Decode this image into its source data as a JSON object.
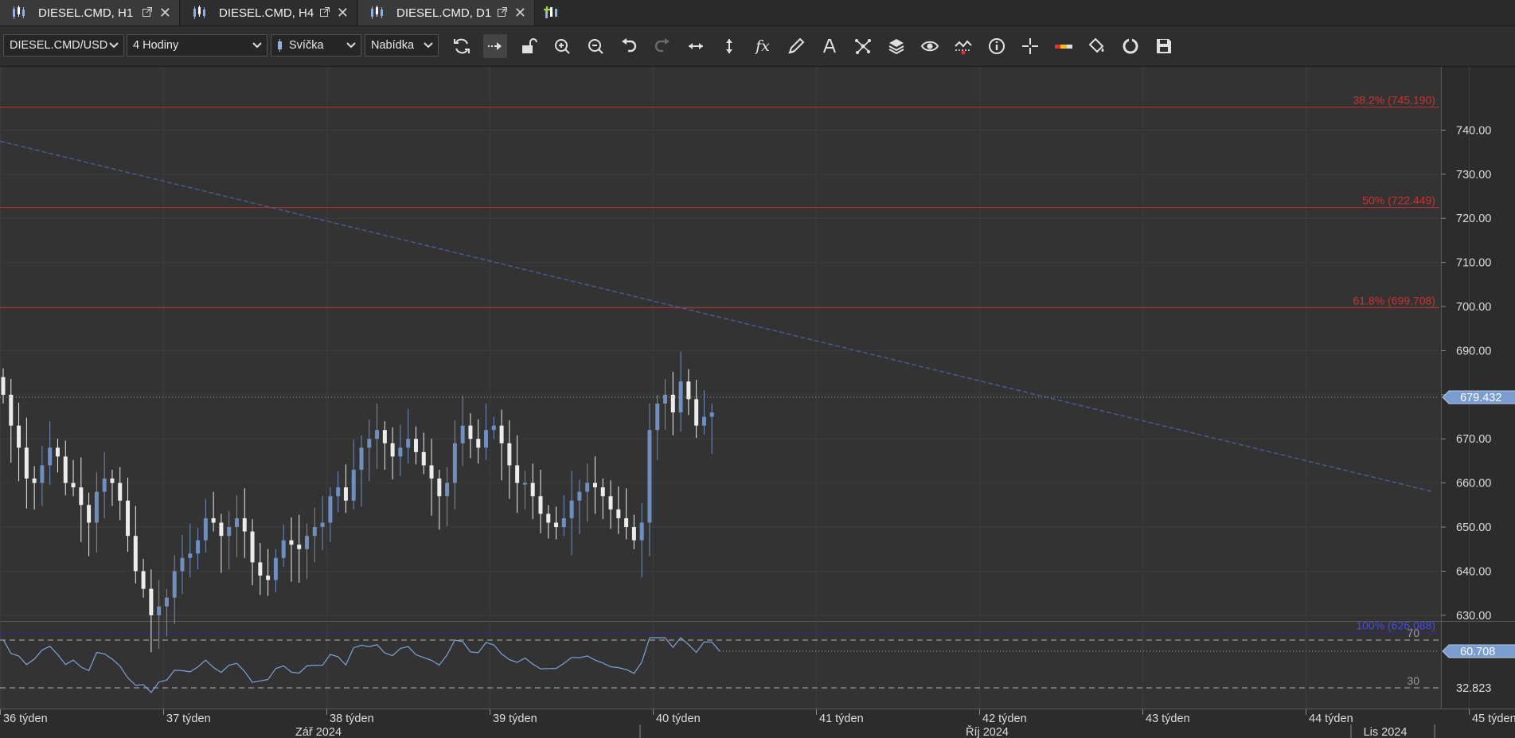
{
  "tabs": [
    {
      "label": "DIESEL.CMD, H1",
      "active": false
    },
    {
      "label": "DIESEL.CMD, H4",
      "active": true
    },
    {
      "label": "DIESEL.CMD, D1",
      "active": false
    }
  ],
  "toolbar": {
    "instrument": "DIESEL.CMD/USD",
    "period": "4 Hodiny",
    "chart_style": "Svíčka",
    "price_side": "Nabídka",
    "fx_label": "fx"
  },
  "colors": {
    "bull": "#6f8fbf",
    "bear": "#ececec",
    "fib": "#c03030",
    "trend": "#4a5d8c",
    "fib100": "#2a2ad0"
  },
  "chart_data": {
    "type": "candlestick",
    "y_ticks": [
      "740.00",
      "730.00",
      "720.00",
      "710.00",
      "700.00",
      "690.00",
      "680.00",
      "670.00",
      "660.00",
      "650.00",
      "640.00",
      "630.00"
    ],
    "ylim": [
      626,
      748
    ],
    "current_price": "679.432",
    "fib_levels": [
      {
        "label": "38.2% (745.190)",
        "value": 745.19
      },
      {
        "label": "50% (722.449)",
        "value": 722.449
      },
      {
        "label": "61.8% (699.708)",
        "value": 699.708
      },
      {
        "label": "100% (626.088)",
        "value": 626.088
      }
    ],
    "trendline": [
      [
        0.0,
        737.5
      ],
      [
        1.0,
        658.0
      ]
    ],
    "x_labels": [
      "36 týden",
      "37 týden",
      "38 týden",
      "39 týden",
      "40 týden",
      "41 týden",
      "42 týden",
      "43 týden",
      "44 týden",
      "45 týden"
    ],
    "month_labels": [
      "Zář 2024",
      "Říj 2024",
      "Lis 2024"
    ],
    "rsi": {
      "upper_label": "70",
      "lower_label": "30",
      "value_label": "60.708",
      "secondary_label": "32.823",
      "upper": 70,
      "lower": 30,
      "current": 60.708
    }
  }
}
